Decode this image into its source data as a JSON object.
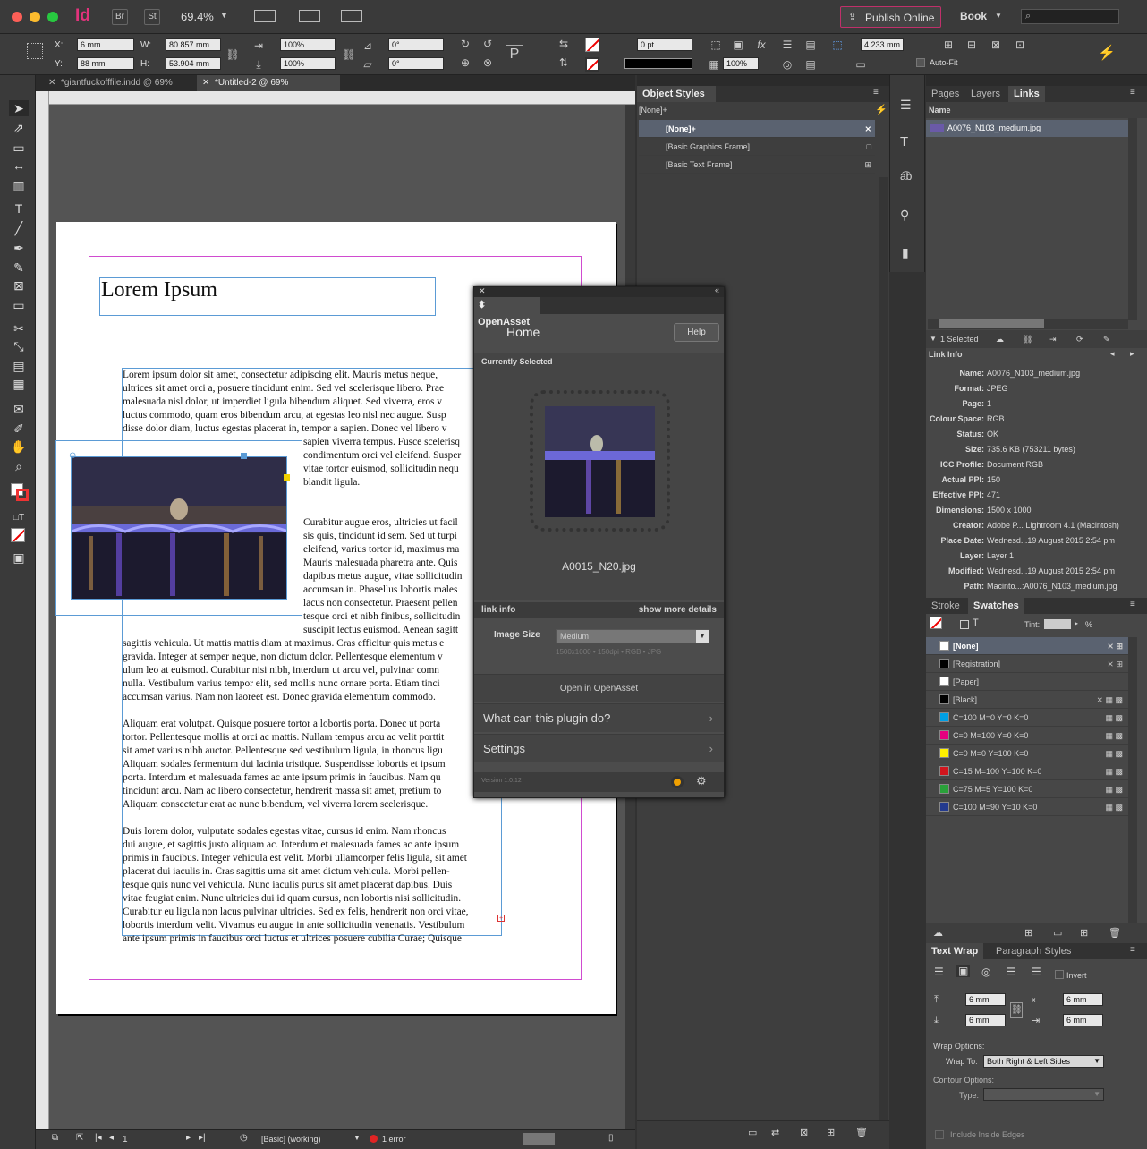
{
  "app": {
    "logo": "Id",
    "bridge": "Br",
    "stock": "St",
    "zoom": "69.4%",
    "publish_label": "Publish Online",
    "workspace": "Book",
    "search_placeholder": ""
  },
  "control": {
    "x_label": "X:",
    "x": "6 mm",
    "y_label": "Y:",
    "y": "88 mm",
    "w_label": "W:",
    "w": "80.857 mm",
    "h_label": "H:",
    "h": "53.904 mm",
    "scale_x": "100%",
    "scale_y": "100%",
    "rot": "0°",
    "shear": "0°",
    "stroke_weight": "0 pt",
    "opacity": "100%",
    "offset": "4.233 mm",
    "autofit": "Auto-Fit"
  },
  "tabs": [
    {
      "label": "*giantfuckofffile.indd @ 69%"
    },
    {
      "label": "*Untitled-2 @ 69%"
    }
  ],
  "document": {
    "heading": "Lorem Ipsum",
    "para1_lines": [
      "Lorem ipsum dolor sit amet, consectetur adipiscing elit. Mauris metus neque,",
      "ultrices sit amet orci a, posuere tincidunt enim. Sed vel scelerisque libero. Prae",
      "malesuada nisl dolor, ut imperdiet ligula bibendum aliquet. Sed viverra, eros v",
      "luctus commodo, quam eros bibendum arcu, at egestas leo nisl nec augue. Susp",
      "disse dolor diam, luctus egestas placerat in, tempor a sapien. Donec vel libero v"
    ],
    "wrap1_lines": [
      "sapien viverra tempus. Fusce scelerisq",
      "condimentum orci vel eleifend. Susper",
      "vitae tortor euismod, sollicitudin nequ",
      "blandit ligula."
    ],
    "wrap2_lines": [
      "Curabitur augue eros, ultricies ut facil",
      "sis quis, tincidunt id sem. Sed ut turpi",
      "eleifend, varius tortor id, maximus ma",
      "Mauris malesuada pharetra ante. Quis",
      "dapibus metus augue, vitae sollicitudin",
      "accumsan in. Phasellus lobortis males",
      "lacus non consectetur. Praesent pellen",
      "tesque orci et nibh finibus, sollicitudin",
      "suscipit lectus euismod. Aenean sagitt"
    ],
    "para2_lines": [
      "sagittis vehicula. Ut mattis mattis diam at maximus. Cras efficitur quis metus e",
      "gravida. Integer at semper neque, non dictum dolor. Pellentesque elementum v",
      "ulum leo at euismod. Curabitur nisi nibh, interdum ut arcu vel, pulvinar comn",
      "nulla. Vestibulum varius tempor elit, sed mollis nunc ornare porta. Etiam tinci",
      "accumsan varius. Nam non laoreet est. Donec gravida elementum commodo."
    ],
    "para3_lines": [
      "Aliquam erat volutpat. Quisque posuere tortor a lobortis porta. Donec ut porta",
      "tortor. Pellentesque mollis at orci ac mattis. Nullam tempus arcu ac velit porttit",
      "sit amet varius nibh auctor. Pellentesque sed vestibulum ligula, in rhoncus ligu",
      "Aliquam sodales fermentum dui lacinia tristique. Suspendisse lobortis et ipsum",
      "porta. Interdum et malesuada fames ac ante ipsum primis in faucibus. Nam qu",
      "tincidunt arcu. Nam ac libero consectetur, hendrerit massa sit amet, pretium to",
      "Aliquam consectetur erat ac nunc bibendum, vel viverra lorem scelerisque."
    ],
    "para4_lines": [
      "Duis lorem dolor, vulputate sodales egestas vitae, cursus id enim. Nam rhoncus",
      "dui augue, et sagittis justo aliquam ac. Interdum et malesuada fames ac ante ipsum",
      "primis in faucibus. Integer vehicula est velit. Morbi ullamcorper felis ligula, sit amet",
      "placerat dui iaculis in. Cras sagittis urna sit amet dictum vehicula. Morbi pellen-",
      "tesque quis nunc vel vehicula. Nunc iaculis purus sit amet placerat dapibus. Duis",
      "vitae feugiat enim. Nunc ultricies dui id quam cursus, non lobortis nisi sollicitudin.",
      "Curabitur eu ligula non lacus pulvinar ultricies. Sed ex felis, hendrerit non orci vitae,",
      "lobortis interdum velit. Vivamus eu augue in ante sollicitudin venenatis. Vestibulum",
      "ante ipsum primis in faucibus orci luctus et ultrices posuere cubilia Curae; Quisque"
    ]
  },
  "status": {
    "page": "1",
    "style": "[Basic] (working)",
    "errors": "1 error"
  },
  "object_styles": {
    "title": "Object Styles",
    "current": "[None]+",
    "items": [
      "[None]+",
      "[Basic Graphics Frame]",
      "[Basic Text Frame]"
    ]
  },
  "links_panel": {
    "tabs": [
      "Pages",
      "Layers",
      "Links"
    ],
    "col_name": "Name",
    "file": "A0076_N103_medium.jpg",
    "selected": "1 Selected",
    "link_info_title": "Link Info"
  },
  "link_info": [
    {
      "k": "Name:",
      "v": "A0076_N103_medium.jpg"
    },
    {
      "k": "Format:",
      "v": "JPEG"
    },
    {
      "k": "Page:",
      "v": "1"
    },
    {
      "k": "Colour Space:",
      "v": "RGB"
    },
    {
      "k": "Status:",
      "v": "OK"
    },
    {
      "k": "Size:",
      "v": "735.6 KB (753211 bytes)"
    },
    {
      "k": "ICC Profile:",
      "v": "Document RGB"
    },
    {
      "k": "Actual PPI:",
      "v": "150"
    },
    {
      "k": "Effective PPI:",
      "v": "471"
    },
    {
      "k": "Dimensions:",
      "v": "1500 x 1000"
    },
    {
      "k": "Creator:",
      "v": "Adobe P... Lightroom 4.1 (Macintosh)"
    },
    {
      "k": "Place Date:",
      "v": "Wednesd...19 August 2015 2:54 pm"
    },
    {
      "k": "Layer:",
      "v": "Layer 1"
    },
    {
      "k": "Modified:",
      "v": "Wednesd...19 August 2015 2:54 pm"
    },
    {
      "k": "Path:",
      "v": "Macinto...:A0076_N103_medium.jpg"
    }
  ],
  "swatches": {
    "tabs": [
      "Stroke",
      "Swatches"
    ],
    "tint_label": "Tint:",
    "percent": "%",
    "items": [
      {
        "name": "[None]",
        "color": "#ffffff"
      },
      {
        "name": "[Registration]",
        "color": "#000000"
      },
      {
        "name": "[Paper]",
        "color": "#ffffff"
      },
      {
        "name": "[Black]",
        "color": "#000000"
      },
      {
        "name": "C=100 M=0 Y=0 K=0",
        "color": "#00a0e6"
      },
      {
        "name": "C=0 M=100 Y=0 K=0",
        "color": "#e4007f"
      },
      {
        "name": "C=0 M=0 Y=100 K=0",
        "color": "#fff100"
      },
      {
        "name": "C=15 M=100 Y=100 K=0",
        "color": "#d2161e"
      },
      {
        "name": "C=75 M=5 Y=100 K=0",
        "color": "#2aa13a"
      },
      {
        "name": "C=100 M=90 Y=10 K=0",
        "color": "#233a8e"
      }
    ]
  },
  "text_wrap": {
    "tabs": [
      "Text Wrap",
      "Paragraph Styles"
    ],
    "invert": "Invert",
    "top": "6 mm",
    "bottom": "6 mm",
    "left": "6 mm",
    "right": "6 mm",
    "wrap_options": "Wrap Options:",
    "wrap_to_label": "Wrap To:",
    "wrap_to": "Both Right & Left Sides",
    "contour_options": "Contour Options:",
    "type_label": "Type:",
    "include_edges": "Include Inside Edges"
  },
  "openasset": {
    "title": "OpenAsset",
    "home": "Home",
    "help": "Help",
    "currently_selected": "Currently Selected",
    "filename": "A0015_N20.jpg",
    "link_info": "link info",
    "show_more": "show more details",
    "image_size_label": "Image Size",
    "image_size": "Medium",
    "image_meta": "1500x1000 • 150dpi • RGB • JPG",
    "open_in": "Open in OpenAsset",
    "what_can": "What can this plugin do?",
    "settings": "Settings",
    "version": "Version 1.0.12"
  }
}
